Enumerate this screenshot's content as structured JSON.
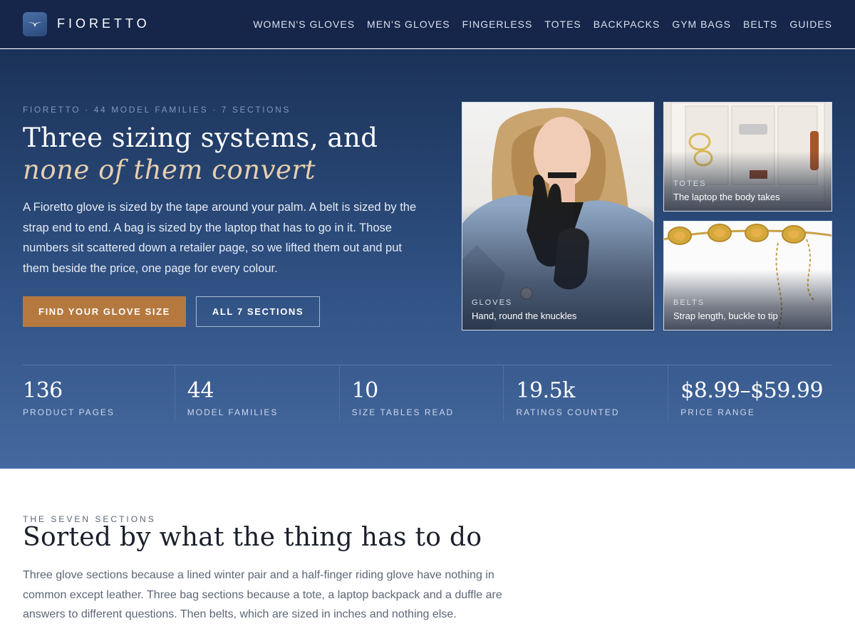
{
  "brand": {
    "name": "FIORETTO",
    "logo_icon": "wing-logo-icon"
  },
  "nav": {
    "links": [
      "WOMEN'S GLOVES",
      "MEN'S GLOVES",
      "FINGERLESS",
      "TOTES",
      "BACKPACKS",
      "GYM BAGS",
      "BELTS",
      "GUIDES"
    ]
  },
  "hero": {
    "eyebrow": "FIORETTO · 44 MODEL FAMILIES · 7 SECTIONS",
    "headline_plain": "Three sizing systems, and ",
    "headline_accent": "none of them convert",
    "lead": "A Fioretto glove is sized by the tape around your palm. A belt is sized by the strap end to end. A bag is sized by the laptop that has to go in it. Those numbers sit scattered down a retailer page, so we lifted them out and put them beside the price, one page for every colour.",
    "primary_cta": "FIND YOUR GLOVE SIZE",
    "secondary_cta": "ALL 7 SECTIONS"
  },
  "tiles": {
    "gloves": {
      "tag": "GLOVES",
      "desc": "Hand, round the knuckles"
    },
    "totes": {
      "tag": "TOTES",
      "desc": "The laptop the body takes"
    },
    "belts": {
      "tag": "BELTS",
      "desc": "Strap length, buckle to tip"
    }
  },
  "stats": [
    {
      "value": "136",
      "label": "PRODUCT PAGES"
    },
    {
      "value": "44",
      "label": "MODEL FAMILIES"
    },
    {
      "value": "10",
      "label": "SIZE TABLES READ"
    },
    {
      "value": "19.5k",
      "label": "RATINGS COUNTED"
    },
    {
      "value": "$8.99–$59.99",
      "label": "PRICE RANGE"
    }
  ],
  "sections": {
    "eyebrow": "THE SEVEN SECTIONS",
    "title": "Sorted by what the thing has to do",
    "body": "Three glove sections because a lined winter pair and a half-finger riding glove have nothing in common except leather. Three bag sections because a tote, a laptop backpack and a duffle are answers to different questions. Then belts, which are sized in inches and nothing else."
  },
  "colors": {
    "nav_bg": "#15264a",
    "hero_top": "#1b3258",
    "hero_bottom": "#4569a0",
    "accent_gold": "#b5793f",
    "headline_accent": "#e6cfae"
  }
}
